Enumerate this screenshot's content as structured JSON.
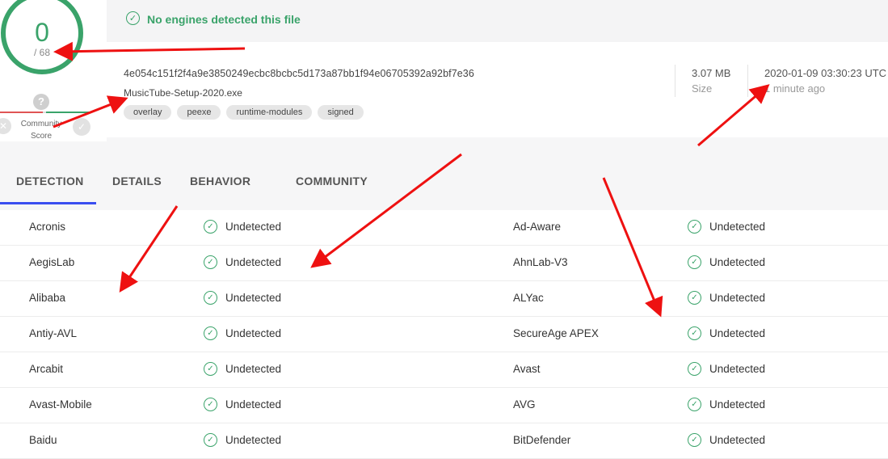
{
  "score": {
    "detected": "0",
    "total": "/ 68"
  },
  "community": {
    "label": "Community Score",
    "question": "?",
    "down": "✕",
    "up": "✓"
  },
  "banner": {
    "text": "No engines detected this file",
    "icon": "check-circle-icon"
  },
  "file": {
    "hash": "4e054c151f2f4a9e3850249ecbc8bcbc5d173a87bb1f94e06705392a92bf7e36",
    "name": "MusicTube-Setup-2020.exe",
    "tags": [
      "overlay",
      "peexe",
      "runtime-modules",
      "signed"
    ],
    "size_value": "3.07 MB",
    "size_label": "Size",
    "date_value": "2020-01-09 03:30:23 UTC",
    "date_label": "1 minute ago"
  },
  "tabs": [
    {
      "label": "DETECTION",
      "active": true
    },
    {
      "label": "DETAILS"
    },
    {
      "label": "BEHAVIOR"
    },
    {
      "label": "COMMUNITY"
    }
  ],
  "detections": [
    {
      "left_engine": "Acronis",
      "left_result": "Undetected",
      "right_engine": "Ad-Aware",
      "right_result": "Undetected"
    },
    {
      "left_engine": "AegisLab",
      "left_result": "Undetected",
      "right_engine": "AhnLab-V3",
      "right_result": "Undetected"
    },
    {
      "left_engine": "Alibaba",
      "left_result": "Undetected",
      "right_engine": "ALYac",
      "right_result": "Undetected"
    },
    {
      "left_engine": "Antiy-AVL",
      "left_result": "Undetected",
      "right_engine": "SecureAge APEX",
      "right_result": "Undetected"
    },
    {
      "left_engine": "Arcabit",
      "left_result": "Undetected",
      "right_engine": "Avast",
      "right_result": "Undetected"
    },
    {
      "left_engine": "Avast-Mobile",
      "left_result": "Undetected",
      "right_engine": "AVG",
      "right_result": "Undetected"
    },
    {
      "left_engine": "Baidu",
      "left_result": "Undetected",
      "right_engine": "BitDefender",
      "right_result": "Undetected"
    }
  ],
  "colors": {
    "accent_green": "#3aa36a",
    "tab_underline": "#3a4ef0",
    "annotation_red": "#ee1111"
  }
}
